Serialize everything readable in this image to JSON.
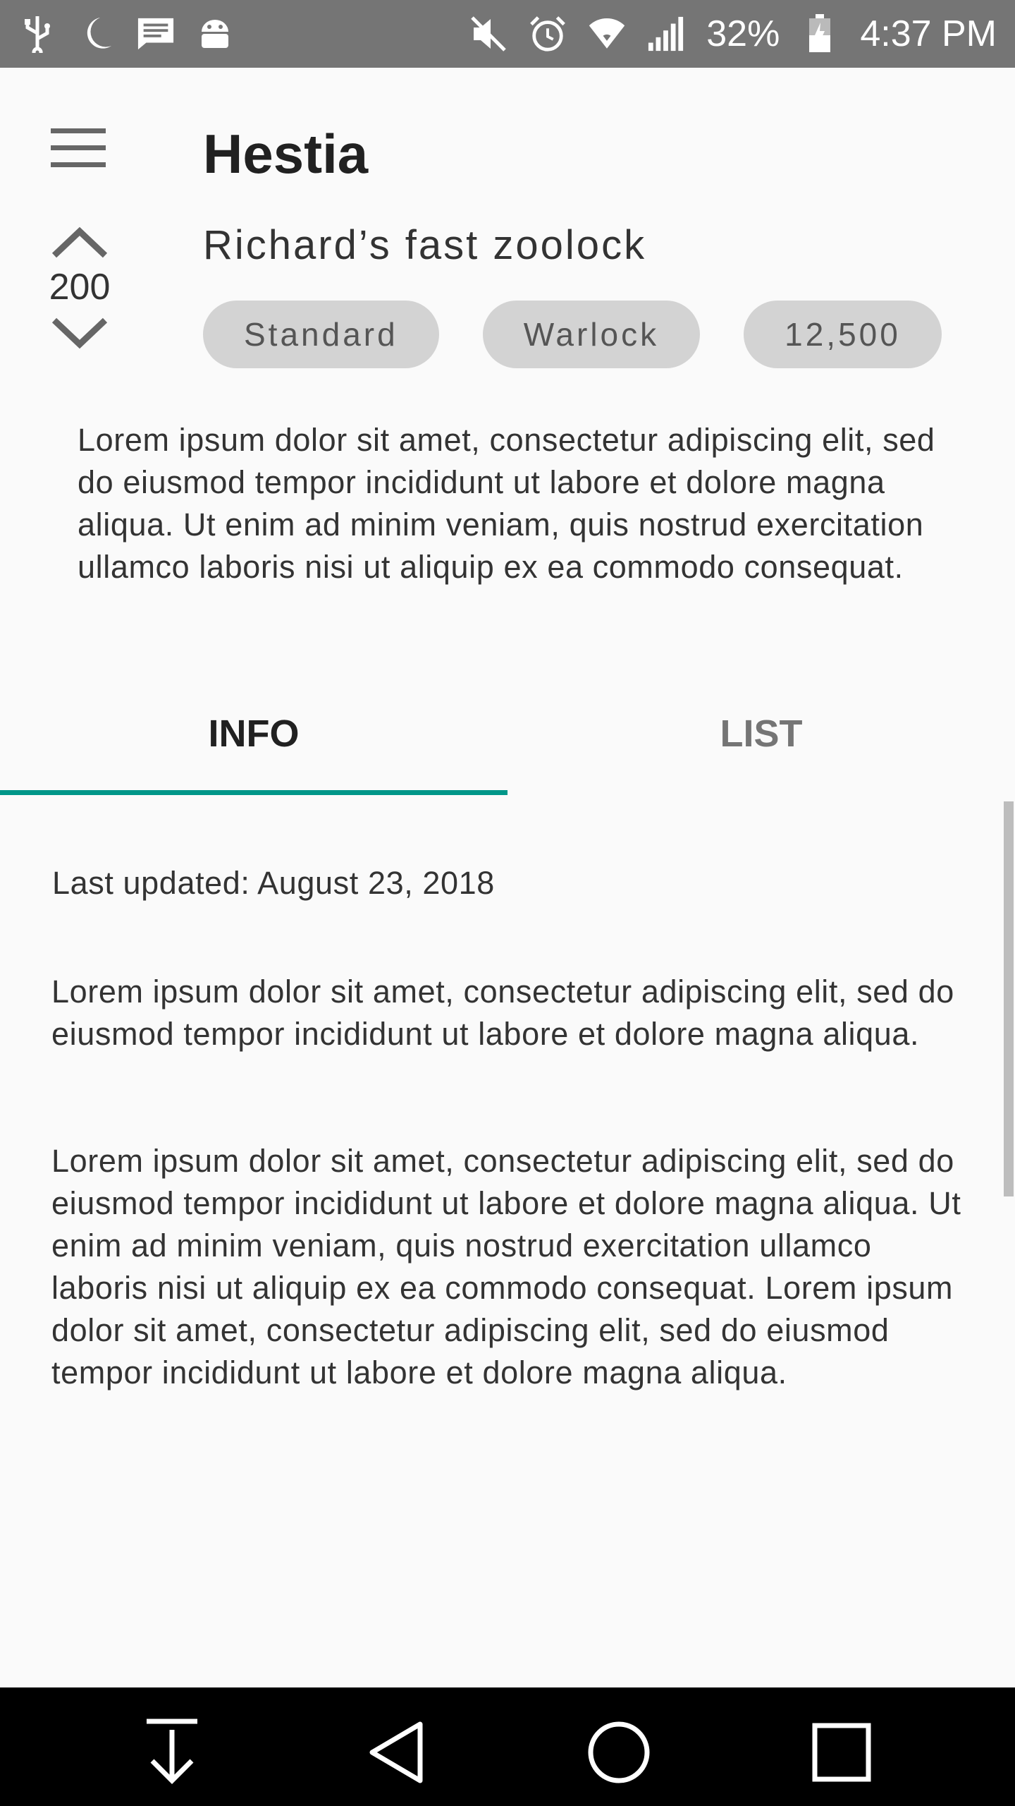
{
  "status_bar": {
    "battery_percent": "32%",
    "time": "4:37 PM",
    "left_icons": [
      "usb-icon",
      "moon-icon",
      "message-icon",
      "android-icon"
    ],
    "right_icons": [
      "mute-icon",
      "alarm-icon",
      "wifi-icon",
      "signal-icon",
      "battery-icon"
    ]
  },
  "header": {
    "title": "Hestia",
    "menu_icon": "hamburger-menu-icon"
  },
  "deck": {
    "name": "Richard’s fast zoolock",
    "votes": "200",
    "tags": [
      "Standard",
      "Warlock",
      "12,500"
    ],
    "description": "Lorem ipsum dolor sit amet, consectetur adipiscing elit, sed do eiusmod tempor incididunt ut labore et dolore magna aliqua. Ut enim ad minim veniam, quis nostrud exercitation ullamco laboris nisi ut aliquip ex ea commodo consequat."
  },
  "tabs": [
    {
      "label": "INFO",
      "selected": true
    },
    {
      "label": "LIST",
      "selected": false
    }
  ],
  "info": {
    "last_updated": "Last updated: August 23, 2018",
    "paragraphs": [
      "Lorem ipsum dolor sit amet, consectetur adipiscing elit, sed do eiusmod tempor incididunt ut labore et dolore magna aliqua.",
      "Lorem ipsum dolor sit amet, consectetur adipiscing elit, sed do eiusmod tempor incididunt ut labore et dolore magna aliqua. Ut enim ad minim veniam, quis nostrud exercitation ullamco laboris nisi ut aliquip ex ea commodo consequat. Lorem ipsum dolor sit amet, consectetur adipiscing elit, sed do eiusmod tempor incididunt ut labore et dolore magna aliqua."
    ]
  },
  "colors": {
    "accent": "#009688",
    "status_bar": "#757575",
    "chip_bg": "#d3d3d3",
    "background": "#fafafa"
  },
  "nav_bar": {
    "buttons": [
      "dismiss-icon",
      "back-icon",
      "home-icon",
      "recents-icon"
    ]
  }
}
